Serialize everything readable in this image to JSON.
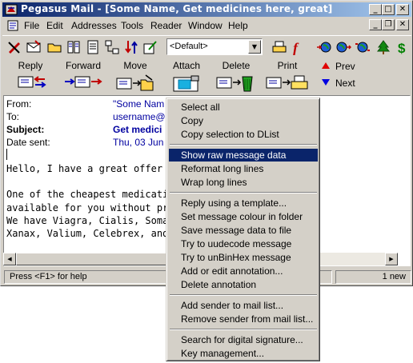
{
  "window": {
    "title": "Pegasus Mail - [Some Name, Get medicines here, great]",
    "caption_buttons": {
      "minimize": "_",
      "maximize": "□",
      "close": "✕"
    },
    "mdi_buttons": {
      "minimize": "_",
      "restore": "❐",
      "close": "✕"
    }
  },
  "menubar": {
    "items": [
      "File",
      "Edit",
      "Addresses",
      "Tools",
      "Reader",
      "Window",
      "Help"
    ]
  },
  "toolbar1": {
    "identity_combo": "<Default>"
  },
  "toolbar2": {
    "reply": "Reply",
    "forward": "Forward",
    "move": "Move",
    "attach": "Attach",
    "delete": "Delete",
    "print": "Print",
    "prev": "Prev",
    "next": "Next"
  },
  "message": {
    "headers": [
      {
        "label": "From:",
        "value": "\"Some Nam",
        "bold": false
      },
      {
        "label": "To:",
        "value": "username@",
        "bold": false
      },
      {
        "label": "Subject:",
        "value": "Get medici",
        "bold": true
      },
      {
        "label": "Date sent:",
        "value": "Thu, 03 Jun",
        "bold": false
      }
    ],
    "body_lines": [
      "Hello, I have a great offer for you...",
      "",
      "One of the cheapest medication sit",
      "available for you without prescriptio",
      "We have Viagra, Cialis, Soma, Me",
      "Xanax, Valium, Celebrex, and more"
    ]
  },
  "statusbar": {
    "hint": "Press <F1> for help",
    "count": "1 new"
  },
  "context_menu": {
    "selected": "Show raw message data",
    "groups": [
      [
        "Select all",
        "Copy",
        "Copy selection to DList"
      ],
      [
        "Show raw message data",
        "Reformat long lines",
        "Wrap long lines"
      ],
      [
        "Reply using a template...",
        "Set message colour in folder",
        "Save message data to file",
        "Try to uudecode message",
        "Try to unBinHex message",
        "Add or edit annotation...",
        "Delete annotation"
      ],
      [
        "Add sender to mail list...",
        "Remove sender from mail list..."
      ],
      [
        "Search for digital signature...",
        "Key management..."
      ]
    ]
  },
  "colors": {
    "title_gradient_start": "#0a246a",
    "title_gradient_end": "#a6caf0",
    "menu_highlight": "#0a246a",
    "header_value_text": "#0000a0",
    "face": "#d4d0c8"
  }
}
